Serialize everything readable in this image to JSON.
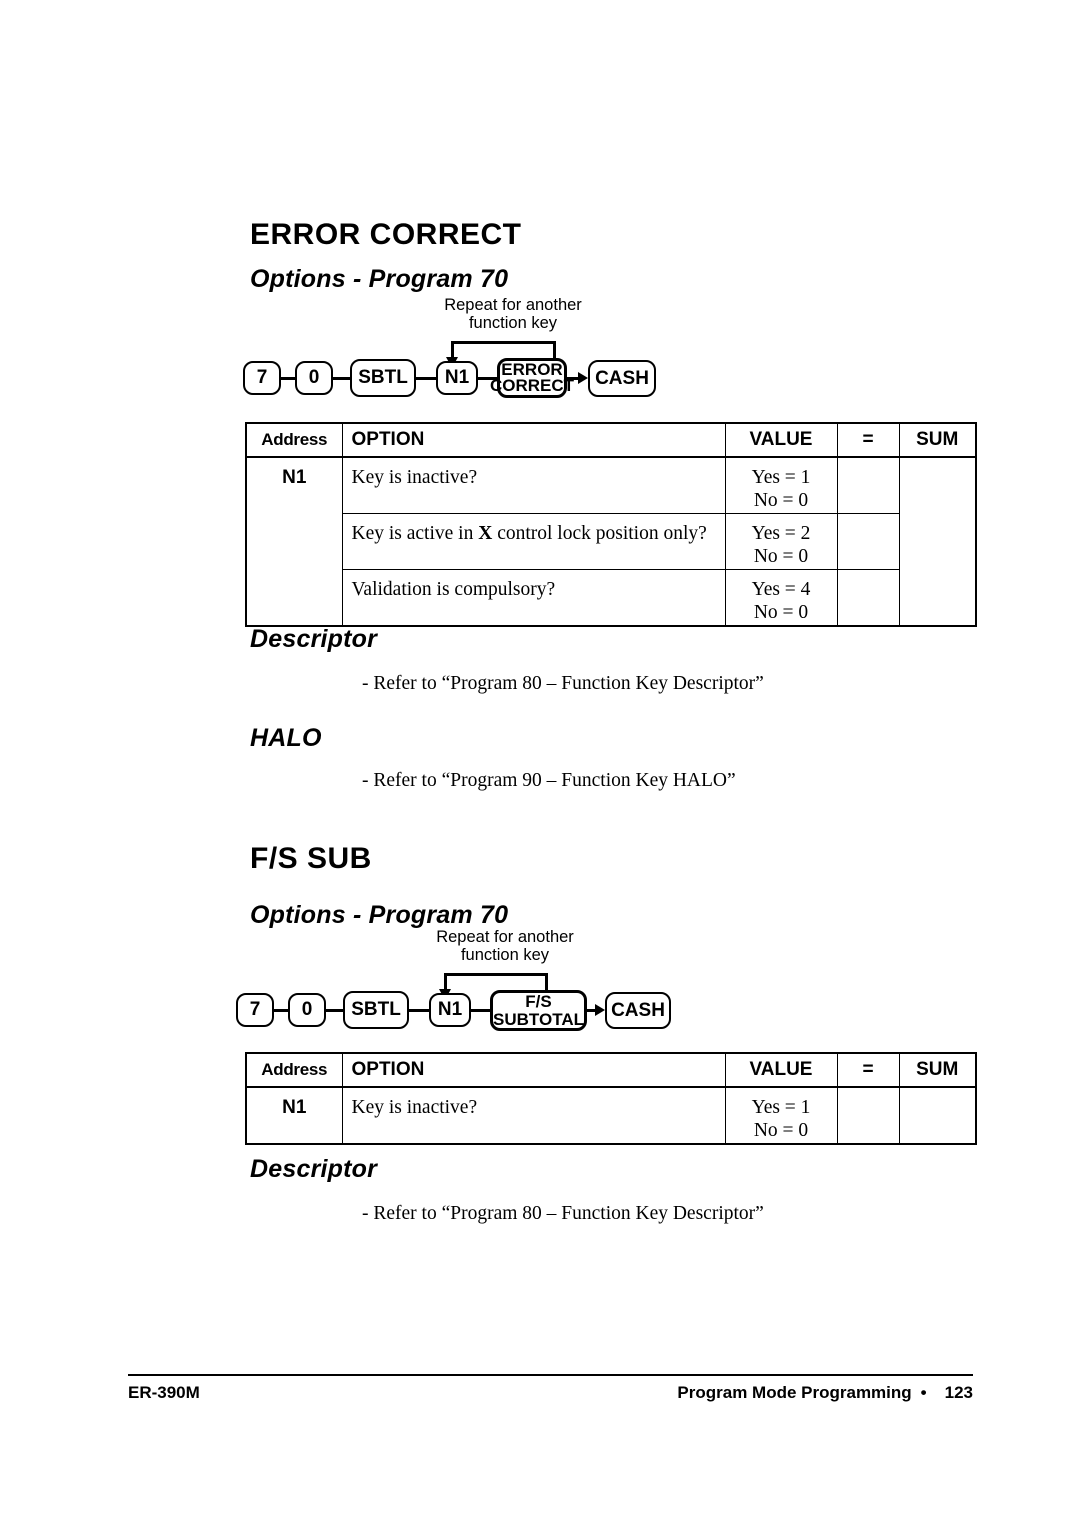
{
  "page": {
    "footer": {
      "model": "ER-390M",
      "section": "Program Mode Programming",
      "separator": "•",
      "page_number": "123"
    }
  },
  "sections": [
    {
      "title": "ERROR CORRECT",
      "options_heading": "Options - Program 70",
      "diagram": {
        "repeat_label_line1": "Repeat for another",
        "repeat_label_line2": "function key",
        "keys": [
          {
            "label": "7",
            "type": "numeric"
          },
          {
            "label": "0",
            "type": "numeric"
          },
          {
            "label": "SBTL",
            "type": "function"
          },
          {
            "label": "N1",
            "type": "address"
          },
          {
            "label": "ERROR CORRECT",
            "line1": "ERROR",
            "line2": "CORRECT",
            "type": "function-key"
          },
          {
            "label": "CASH",
            "type": "tender"
          }
        ]
      },
      "table": {
        "headers": [
          "Address",
          "OPTION",
          "VALUE",
          "=",
          "SUM"
        ],
        "address": "N1",
        "rows": [
          {
            "option": "Key is inactive?",
            "option_pre": "Key is inactive?",
            "option_bold": "",
            "option_post": "",
            "value_yes": "Yes = 1",
            "value_no": "No = 0"
          },
          {
            "option": "Key is active in X control lock position only?",
            "option_pre": "Key is active in ",
            "option_bold": "X",
            "option_post": " control lock position only?",
            "value_yes": "Yes = 2",
            "value_no": "No = 0"
          },
          {
            "option": "Validation is compulsory?",
            "option_pre": "Validation is compulsory?",
            "option_bold": "",
            "option_post": "",
            "value_yes": "Yes = 4",
            "value_no": "No = 0"
          }
        ]
      },
      "descriptor_heading": "Descriptor",
      "descriptor_ref": "- Refer to “Program 80 – Function Key Descriptor”",
      "halo_heading": "HALO",
      "halo_ref": "- Refer to “Program 90 – Function Key HALO”"
    },
    {
      "title": "F/S SUB",
      "options_heading": "Options - Program 70",
      "diagram": {
        "repeat_label_line1": "Repeat for another",
        "repeat_label_line2": "function key",
        "keys": [
          {
            "label": "7",
            "type": "numeric"
          },
          {
            "label": "0",
            "type": "numeric"
          },
          {
            "label": "SBTL",
            "type": "function"
          },
          {
            "label": "N1",
            "type": "address"
          },
          {
            "label": "F/S SUBTOTAL",
            "line1": "F/S",
            "line2": "SUBTOTAL",
            "type": "function-key"
          },
          {
            "label": "CASH",
            "type": "tender"
          }
        ]
      },
      "table": {
        "headers": [
          "Address",
          "OPTION",
          "VALUE",
          "=",
          "SUM"
        ],
        "address": "N1",
        "rows": [
          {
            "option": "Key is inactive?",
            "option_pre": "Key is inactive?",
            "option_bold": "",
            "option_post": "",
            "value_yes": "Yes = 1",
            "value_no": "No = 0"
          }
        ]
      },
      "descriptor_heading": "Descriptor",
      "descriptor_ref": "- Refer to “Program 80 – Function Key Descriptor”"
    }
  ]
}
